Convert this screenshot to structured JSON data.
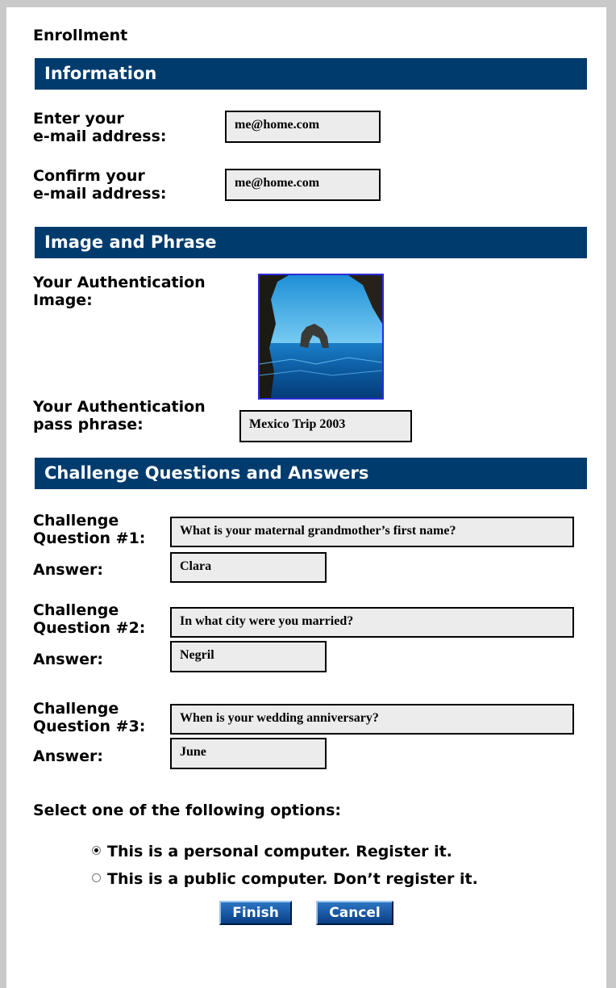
{
  "page": {
    "title": "Enrollment"
  },
  "sections": {
    "information": "Information",
    "image_phrase": "Image and Phrase",
    "challenge": "Challenge Questions and Answers"
  },
  "email": {
    "enter_label_line1": "Enter your",
    "enter_label_line2": "e-mail address:",
    "enter_value": "me@home.com",
    "confirm_label_line1": "Confirm your",
    "confirm_label_line2": "e-mail address:",
    "confirm_value": "me@home.com"
  },
  "auth": {
    "image_label_line1": "Your Authentication",
    "image_label_line2": "Image:",
    "phrase_label_line1": "Your Authentication",
    "phrase_label_line2": "pass phrase:",
    "phrase_value": "Mexico Trip 2003"
  },
  "challenges": [
    {
      "label_line1": "Challenge",
      "label_line2": "Question #1:",
      "question": "What is your maternal grandmother’s first name?",
      "answer_label": "Answer:",
      "answer": "Clara"
    },
    {
      "label_line1": "Challenge",
      "label_line2": "Question #2:",
      "question": "In what city were you married?",
      "answer_label": "Answer:",
      "answer": "Negril"
    },
    {
      "label_line1": "Challenge",
      "label_line2": "Question #3:",
      "question": "When is your wedding anniversary?",
      "answer_label": "Answer:",
      "answer": "June"
    }
  ],
  "options": {
    "prompt": "Select one of the following options:",
    "personal": "This is a personal computer. Register it.",
    "public": "This is a public computer. Don’t register it.",
    "selected": "personal"
  },
  "buttons": {
    "finish": "Finish",
    "cancel": "Cancel"
  },
  "colors": {
    "banner": "#003b6e",
    "field_bg": "#ececec",
    "button": "#0a3f86"
  }
}
